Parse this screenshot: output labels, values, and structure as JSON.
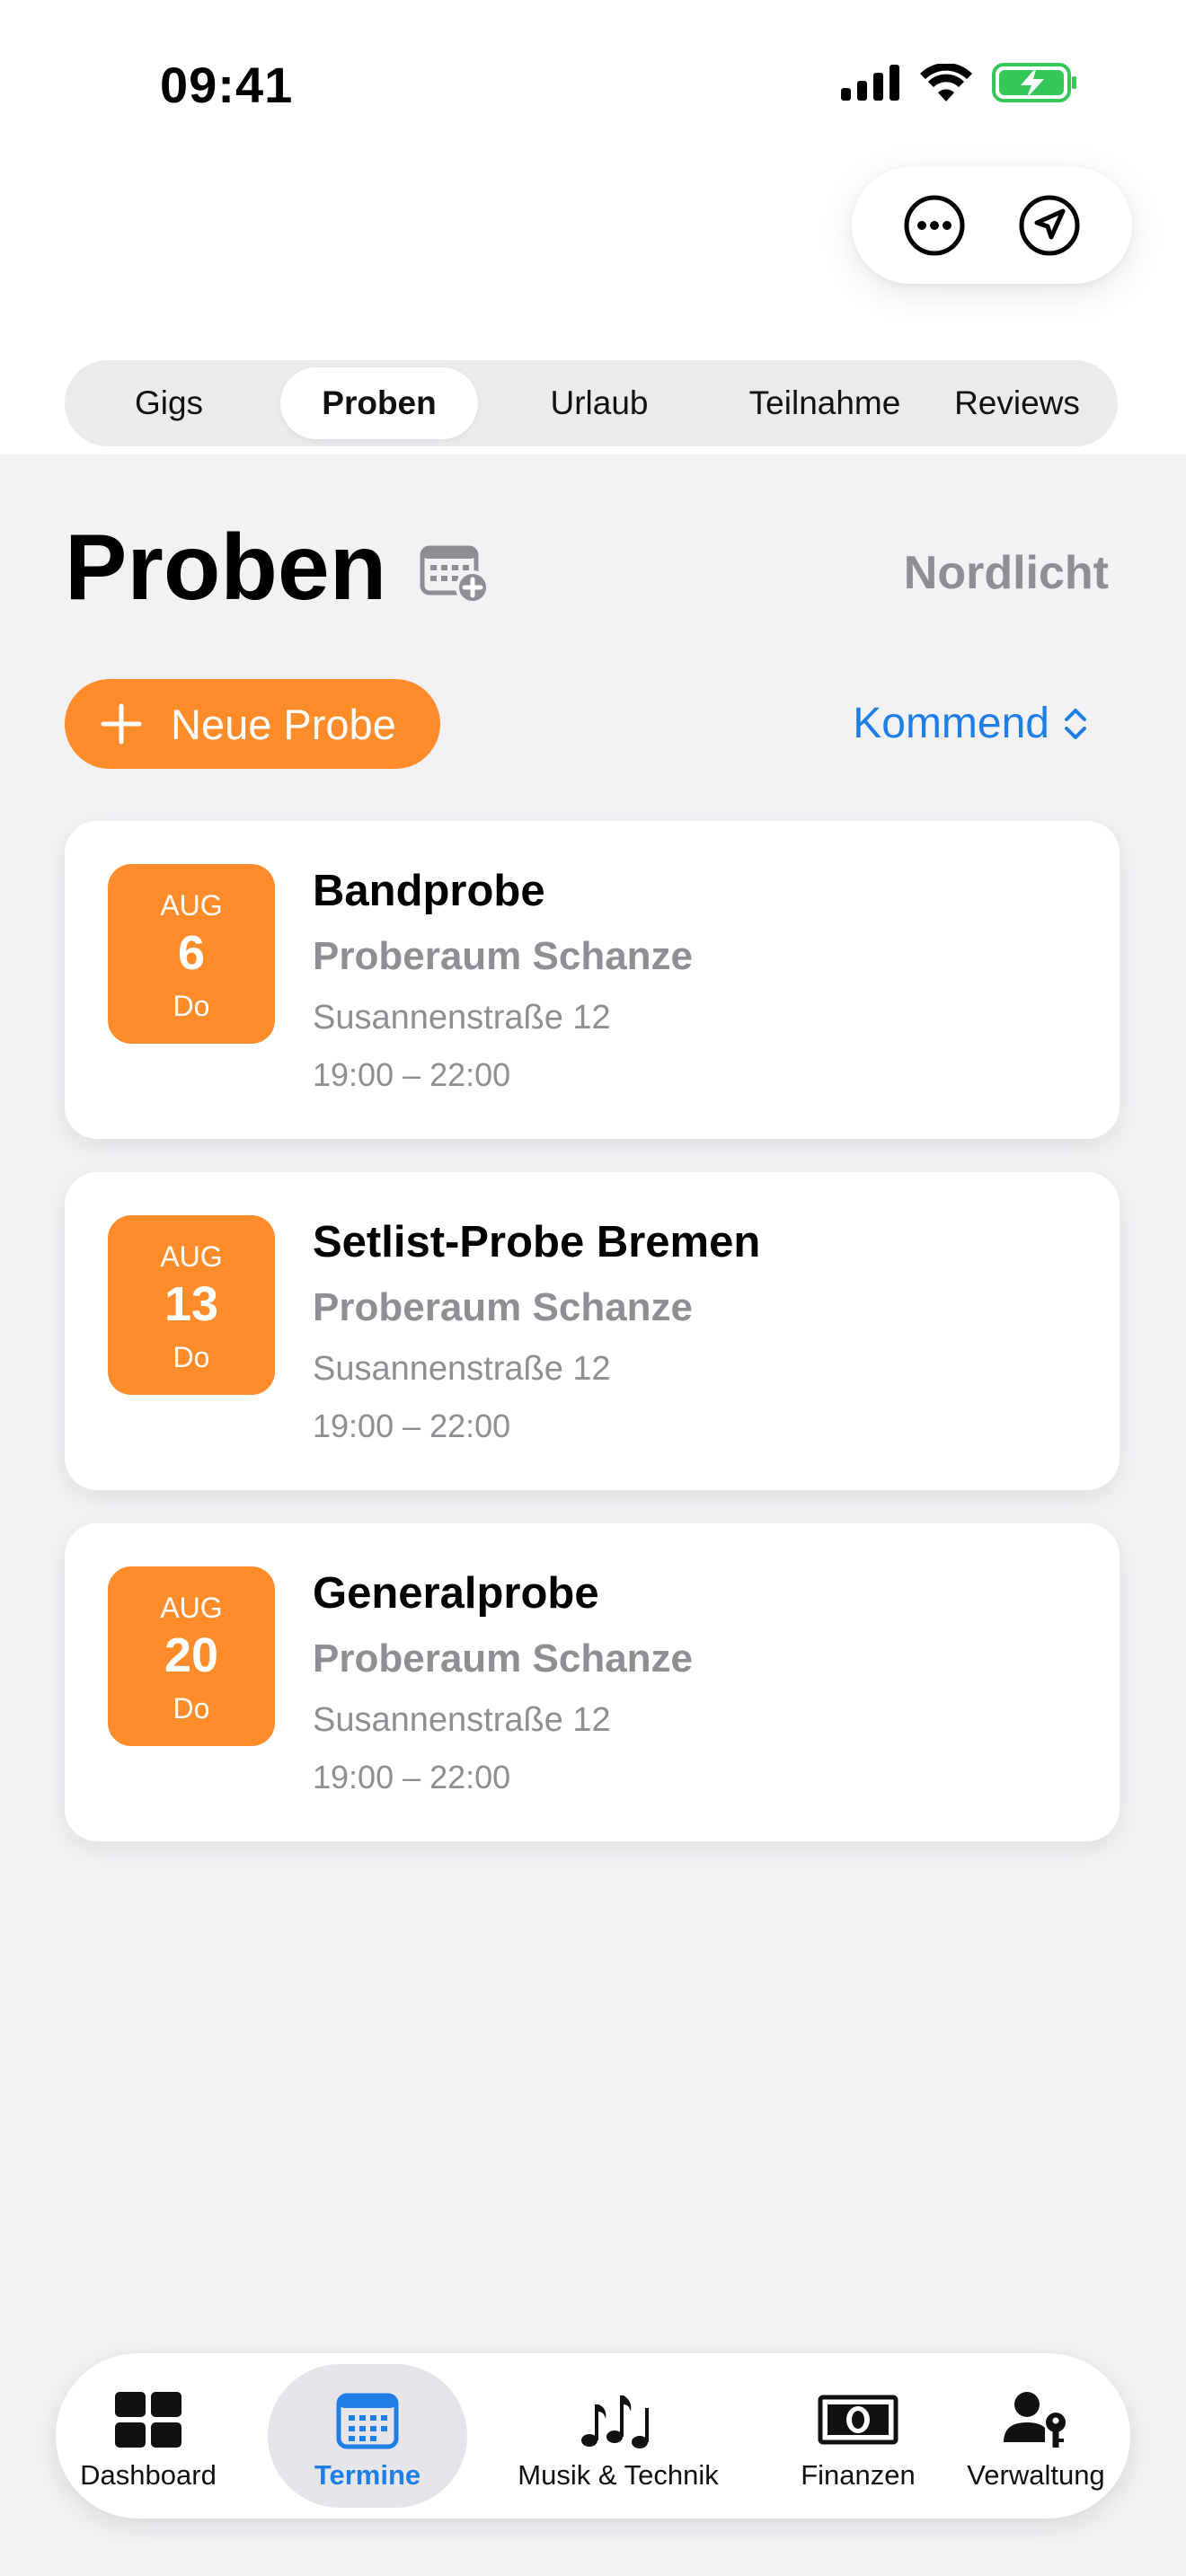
{
  "status_bar": {
    "time": "09:41"
  },
  "header": {
    "actions": [
      {
        "icon": "ellipsis-circle-icon"
      },
      {
        "icon": "location-arrow-icon"
      }
    ]
  },
  "segments": [
    {
      "label": "Gigs",
      "active": false
    },
    {
      "label": "Proben",
      "active": true
    },
    {
      "label": "Urlaub",
      "active": false
    },
    {
      "label": "Teilnahme",
      "active": false
    },
    {
      "label": "Reviews",
      "active": false
    }
  ],
  "page": {
    "title": "Proben",
    "title_icon": "calendar-add-icon",
    "band_name": "Nordlicht",
    "new_button_label": "Neue Probe",
    "filter_label": "Kommend"
  },
  "rehearsals": [
    {
      "month": "AUG",
      "day": "6",
      "weekday": "Do",
      "title": "Bandprobe",
      "venue": "Proberaum Schanze",
      "address": "Susannenstraße 12",
      "time": "19:00 – 22:00"
    },
    {
      "month": "AUG",
      "day": "13",
      "weekday": "Do",
      "title": "Setlist-Probe Bremen",
      "venue": "Proberaum Schanze",
      "address": "Susannenstraße 12",
      "time": "19:00 – 22:00"
    },
    {
      "month": "AUG",
      "day": "20",
      "weekday": "Do",
      "title": "Generalprobe",
      "venue": "Proberaum Schanze",
      "address": "Susannenstraße 12",
      "time": "19:00 – 22:00"
    }
  ],
  "tabbar": [
    {
      "label": "Dashboard",
      "icon": "dashboard-grid-icon",
      "active": false
    },
    {
      "label": "Termine",
      "icon": "calendar-icon",
      "active": true
    },
    {
      "label": "Musik & Technik",
      "icon": "music-notes-icon",
      "active": false
    },
    {
      "label": "Finanzen",
      "icon": "banknote-icon",
      "active": false
    },
    {
      "label": "Verwaltung",
      "icon": "person-key-icon",
      "active": false
    }
  ],
  "colors": {
    "accent": "#ff8c2b",
    "link": "#1e7ee6",
    "secondary_text": "#8e8e93",
    "battery": "#34c759"
  }
}
